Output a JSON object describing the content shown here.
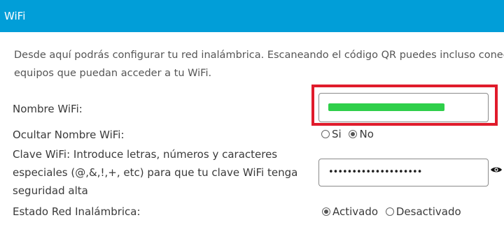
{
  "header": {
    "title": "WiFi"
  },
  "description": {
    "line1": "Desde aquí podrás configurar tu red inalámbrica. Escaneando el código QR puedes incluso conectar",
    "line2": "equipos que puedan acceder a tu WiFi."
  },
  "form": {
    "ssid": {
      "label": "Nombre WiFi:",
      "value_redacted": true
    },
    "hide_ssid": {
      "label": "Ocultar Nombre WiFi:",
      "options": [
        {
          "label": "Si",
          "checked": false
        },
        {
          "label": "No",
          "checked": true
        }
      ]
    },
    "password": {
      "label_line1": "Clave WiFi: Introduce letras, números y caracteres",
      "label_line2": "especiales (@,&,!,+, etc) para que tu clave WiFi tenga",
      "label_line3": "seguridad alta",
      "masked_value": "••••••••••••••••••••",
      "toggle_icon": "eye-icon"
    },
    "wireless_state": {
      "label": "Estado Red Inalámbrica:",
      "options": [
        {
          "label": "Activado",
          "checked": true
        },
        {
          "label": "Desactivado",
          "checked": false
        }
      ]
    }
  },
  "colors": {
    "header_bg": "#019ed8",
    "highlight_border": "#e01b2b",
    "redaction": "#2fcf4a"
  }
}
